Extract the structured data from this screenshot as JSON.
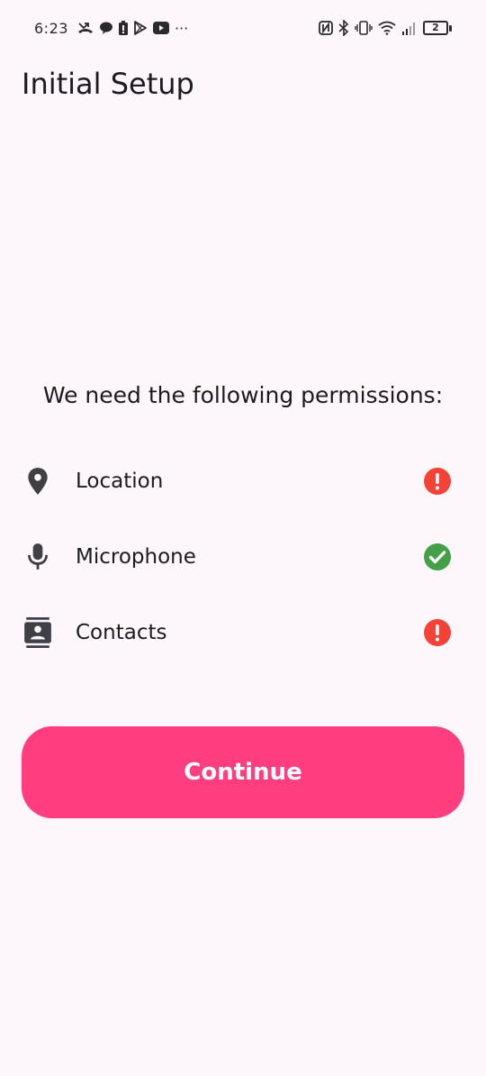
{
  "status_bar": {
    "time": "6:23",
    "battery_level": "2",
    "left_icons": [
      "missed-call-icon",
      "chat-bubble-icon",
      "battery-saver-icon",
      "play-store-icon",
      "youtube-icon",
      "more-dots-icon"
    ],
    "right_icons": [
      "nfc-icon",
      "bluetooth-icon",
      "vibrate-icon",
      "wifi-icon",
      "cell-signal-icon",
      "battery-icon"
    ],
    "more_label": "···"
  },
  "app_bar": {
    "title": "Initial Setup"
  },
  "main": {
    "heading": "We need the following permissions:",
    "permissions": [
      {
        "label": "Location",
        "icon": "location-pin-icon",
        "status": "denied",
        "status_color": "#f44336"
      },
      {
        "label": "Microphone",
        "icon": "microphone-icon",
        "status": "granted",
        "status_color": "#43a047"
      },
      {
        "label": "Contacts",
        "icon": "contacts-icon",
        "status": "denied",
        "status_color": "#f44336"
      }
    ],
    "continue_label": "Continue"
  },
  "colors": {
    "background": "#fdf7fc",
    "accent": "#ff3d7f",
    "granted": "#43a047",
    "denied": "#f44336"
  }
}
